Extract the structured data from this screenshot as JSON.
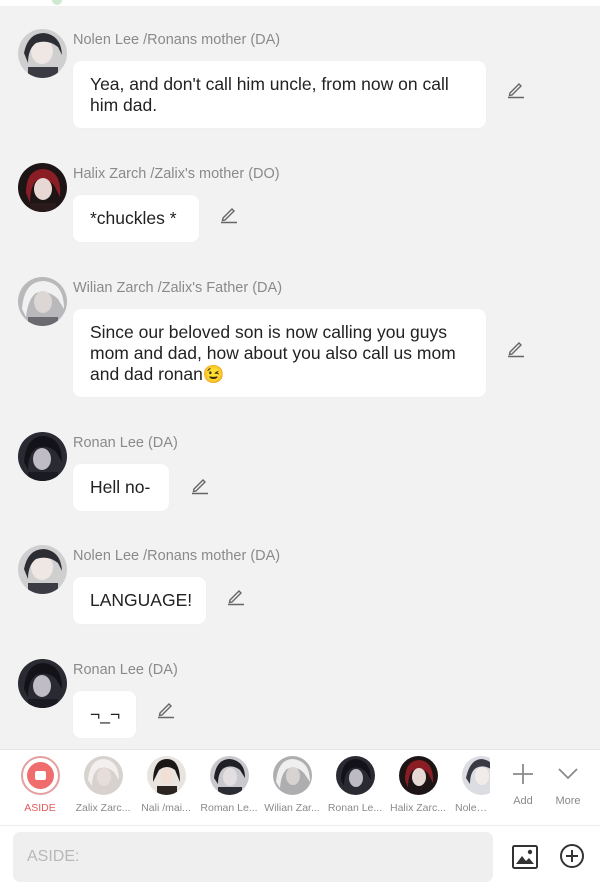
{
  "messages": [
    {
      "name": "Nolen Lee /Ronans mother (DA)",
      "text": "Yea, and don't call him uncle, from now on call him dad."
    },
    {
      "name": "Halix Zarch /Zalix's mother (DO)",
      "text": "*chuckles *"
    },
    {
      "name": "Wilian Zarch /Zalix's Father (DA)",
      "text": "Since our beloved son is now calling you guys mom and dad, how about you also call us mom and dad ronan😉"
    },
    {
      "name": "Ronan Lee (DA)",
      "text": "Hell no-"
    },
    {
      "name": "Nolen Lee /Ronans mother (DA)",
      "text": "LANGUAGE!"
    },
    {
      "name": "Ronan Lee (DA)",
      "text": "¬_¬"
    }
  ],
  "characters": [
    {
      "label": "ASIDE"
    },
    {
      "label": "Zalix Zarc..."
    },
    {
      "label": "Nali /mai..."
    },
    {
      "label": "Roman Le..."
    },
    {
      "label": "Wilian Zar..."
    },
    {
      "label": "Ronan Le..."
    },
    {
      "label": "Halix Zarc..."
    },
    {
      "label": "Nolen L..."
    }
  ],
  "tools": {
    "add": "Add",
    "more": "More"
  },
  "composer": {
    "placeholder": "ASIDE:"
  },
  "colors": {
    "accent": "#ef6d6d",
    "background": "#f2f2f3",
    "bubble": "#ffffff"
  },
  "icons": {
    "edit": "pencil-icon",
    "add": "plus-icon",
    "more": "chevron-down-icon",
    "image": "image-icon",
    "plus_circle": "plus-circle-icon"
  }
}
